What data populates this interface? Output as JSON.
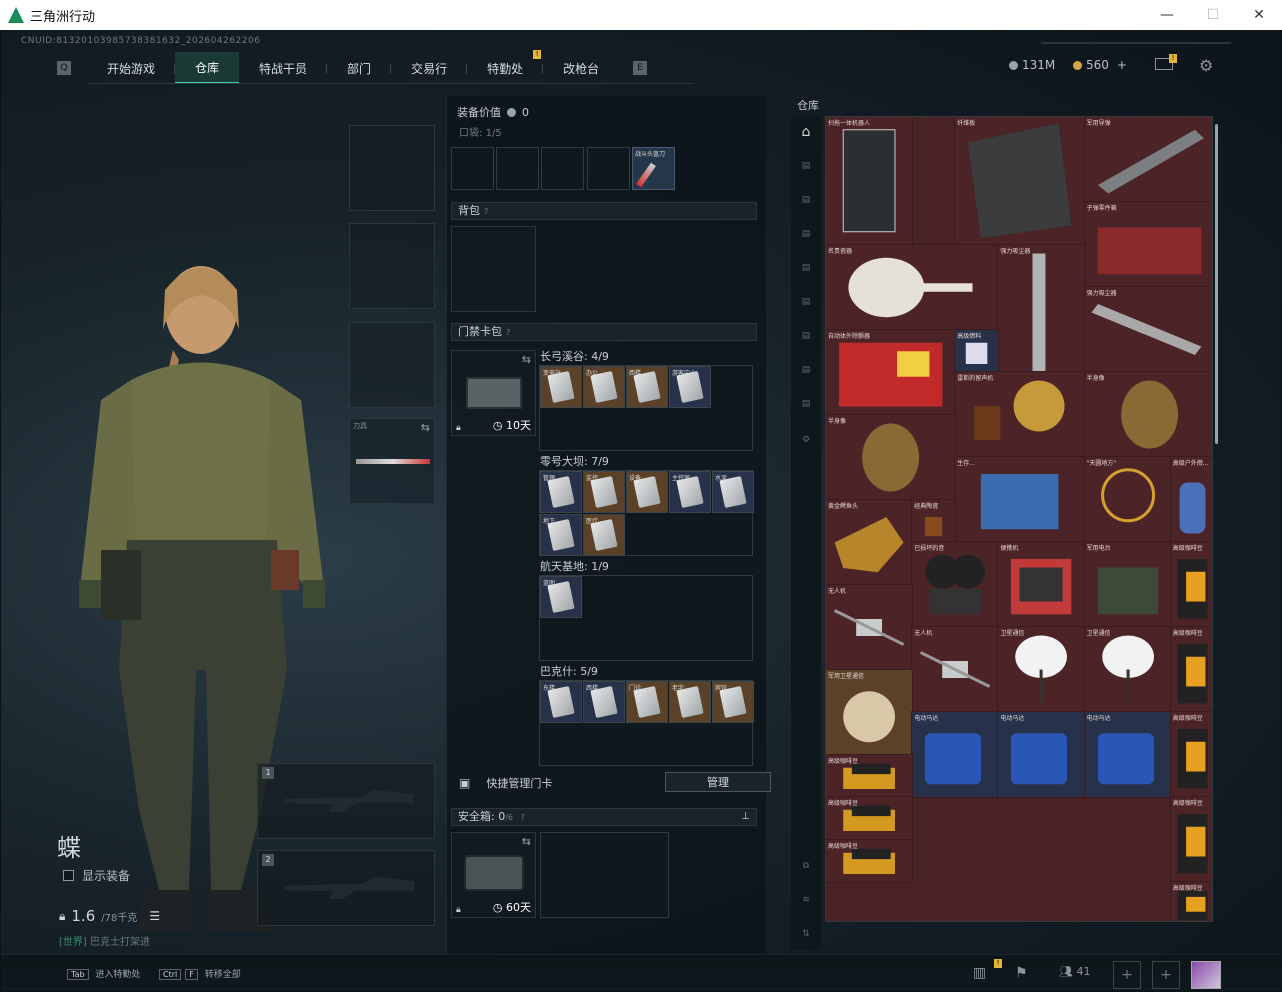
{
  "window": {
    "title": "三角洲行动",
    "minimize": "—",
    "maximize": "☐",
    "close": "✕"
  },
  "uid": "CNUID:8132010398573838163​2_202604262206",
  "nav": {
    "key_left": "Q",
    "key_right": "E",
    "tabs": [
      {
        "label": "开始游戏",
        "active": false
      },
      {
        "label": "仓库",
        "active": true
      },
      {
        "label": "特战干员",
        "active": false
      },
      {
        "label": "部门",
        "active": false
      },
      {
        "label": "交易行",
        "active": false
      },
      {
        "label": "特勤处",
        "active": false
      },
      {
        "label": "改枪台",
        "active": false
      }
    ],
    "badge": "!"
  },
  "currency": {
    "silver": "131M",
    "gold": "560",
    "plus": "+"
  },
  "character": {
    "name": "蝶",
    "show_equipment": "显示装备",
    "weight": "1.6",
    "weight_max": "/78千克",
    "world_channel": "[世界]",
    "world_msg": "巴克士打架进"
  },
  "slots": {
    "melee_label": "刀具",
    "weapon1": "1",
    "weapon2": "2"
  },
  "middle": {
    "equip_value_label": "装备价值",
    "equip_value": "0",
    "pocket_label": "口袋:",
    "pocket_count": "1",
    "pocket_max": "/5",
    "pocket_item": "战斗头盔刀",
    "backpack_label": "背包",
    "keycard_label": "门禁卡包",
    "keycard_days": "10天",
    "groups": [
      {
        "title": "长弓溪谷: 4/9",
        "cards": [
          "变电站",
          "办公",
          "西楼",
          "游客中心"
        ]
      },
      {
        "title": "零号大坝: 7/9",
        "cards": [
          "管理",
          "监控",
          "设备",
          "主控室",
          "水泥",
          "地下",
          "医疗"
        ]
      },
      {
        "title": "航天基地: 1/9",
        "cards": [
          "蓝图"
        ]
      },
      {
        "title": "巴克什: 5/9",
        "cards": [
          "东楼",
          "西楼",
          "门诊",
          "老宅",
          "宾馆"
        ]
      }
    ],
    "quick_manage": "快捷管理门卡",
    "manage_button": "管理",
    "safebox_label": "安全箱:",
    "safebox_count": "0",
    "safebox_max": "/6",
    "safebox_days": "60天"
  },
  "stash": {
    "title": "仓库",
    "items": [
      {
        "name": "扫拖一体机器人",
        "color": "red"
      },
      {
        "name": "纤维板",
        "color": "red"
      },
      {
        "name": "军用导弹",
        "color": "red"
      },
      {
        "name": "子弹零件箱",
        "color": "red"
      },
      {
        "name": "名贵瓷器",
        "color": "red"
      },
      {
        "name": "强力吸尘器",
        "color": "red"
      },
      {
        "name": "强力吸尘器",
        "color": "red"
      },
      {
        "name": "自动体外除颤器",
        "color": "red"
      },
      {
        "name": "高级燃料",
        "color": "blue"
      },
      {
        "name": "雷斯的留声机",
        "color": "red"
      },
      {
        "name": "半身像",
        "color": "red"
      },
      {
        "name": "半身像",
        "color": "red"
      },
      {
        "name": "生存...",
        "color": "red"
      },
      {
        "name": "\"天圆地方\"",
        "color": "red"
      },
      {
        "name": "高级户外燃...",
        "color": "red"
      },
      {
        "name": "黄金鳄鱼头",
        "color": "red"
      },
      {
        "name": "经典陶瓷",
        "color": "red"
      },
      {
        "name": "已损坏的音",
        "color": "red"
      },
      {
        "name": "便携机",
        "color": "red"
      },
      {
        "name": "军用电台",
        "color": "red"
      },
      {
        "name": "高级咖啡豆",
        "color": "red"
      },
      {
        "name": "无人机",
        "color": "red"
      },
      {
        "name": "无人机",
        "color": "red"
      },
      {
        "name": "卫星通信",
        "color": "red"
      },
      {
        "name": "卫星通信",
        "color": "red"
      },
      {
        "name": "高级咖啡豆",
        "color": "red"
      },
      {
        "name": "军用卫星通信",
        "color": "gold"
      },
      {
        "name": "电动马达",
        "color": "blue"
      },
      {
        "name": "电动马达",
        "color": "blue"
      },
      {
        "name": "电动马达",
        "color": "blue"
      },
      {
        "name": "高级咖啡豆",
        "color": "red"
      },
      {
        "name": "高级咖啡豆",
        "color": "red"
      },
      {
        "name": "高级咖啡豆",
        "color": "red"
      },
      {
        "name": "高级咖啡豆",
        "color": "red"
      },
      {
        "name": "高级咖啡豆",
        "color": "red"
      },
      {
        "name": "高级咖啡豆",
        "color": "red"
      }
    ]
  },
  "bottom": {
    "tab_key": "Tab",
    "tab_label": "进入特勤处",
    "ctrl_key": "Ctrl",
    "f_key": "F",
    "ctrl_label": "转移全部",
    "players": "41"
  }
}
